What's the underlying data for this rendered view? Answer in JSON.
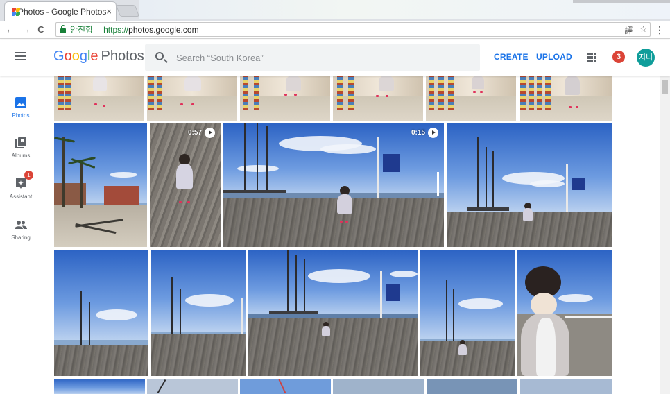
{
  "browser": {
    "tab_title": "Photos - Google Photos",
    "tab_close": "×",
    "secure_label": "안전함",
    "url_proto": "https://",
    "url_host": "photos.google.com",
    "back": "←",
    "forward": "→",
    "reload": "C",
    "translate_icon": "譯",
    "bookmark_star": "☆",
    "menu": "⋮"
  },
  "header": {
    "logo_g": [
      "G",
      "o",
      "o",
      "g",
      "l",
      "e"
    ],
    "logo_colors": [
      "#4285f4",
      "#ea4335",
      "#fbbc05",
      "#4285f4",
      "#34a853",
      "#ea4335"
    ],
    "logo_product": "Photos",
    "search_placeholder": "Search “South Korea”",
    "create_label": "CREATE",
    "upload_label": "UPLOAD",
    "notification_count": "3",
    "avatar_initials": "지니"
  },
  "sidebar": {
    "items": [
      {
        "label": "Photos",
        "icon": "photo-icon",
        "active": true
      },
      {
        "label": "Albums",
        "icon": "albums-icon",
        "active": false
      },
      {
        "label": "Assistant",
        "icon": "assistant-icon",
        "active": false,
        "badge": "1"
      },
      {
        "label": "Sharing",
        "icon": "sharing-icon",
        "active": false
      }
    ]
  },
  "photos": {
    "video_durations": [
      "0:57",
      "0:15"
    ]
  },
  "colors": {
    "accent": "#1a73e8",
    "badge": "#db4437",
    "avatar": "#0f9d9a"
  }
}
